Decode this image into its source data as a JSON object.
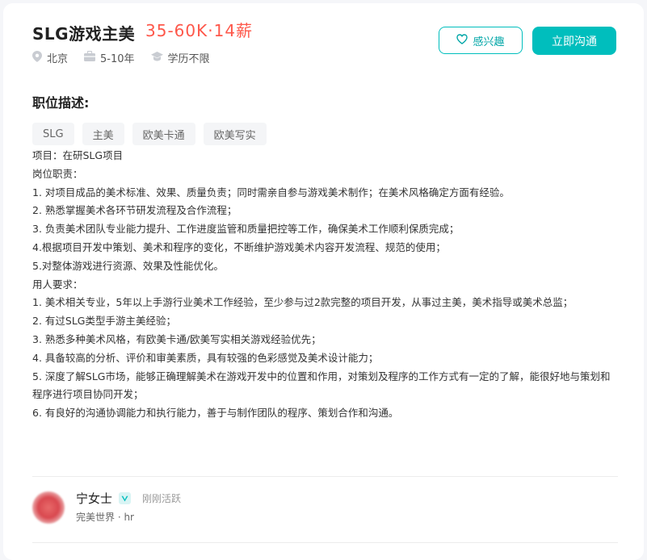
{
  "job": {
    "title": "SLG游戏主美",
    "salary": "35-60K·14薪",
    "location": "北京",
    "experience": "5-10年",
    "education": "学历不限"
  },
  "actions": {
    "interest_label": "感兴趣",
    "contact_label": "立即沟通"
  },
  "description": {
    "section_title": "职位描述:",
    "tags": [
      "SLG",
      "主美",
      "欧美卡通",
      "欧美写实"
    ],
    "lines": [
      "项目：在研SLG项目",
      "岗位职责：",
      "1. 对项目成品的美术标准、效果、质量负责；同时需亲自参与游戏美术制作；在美术风格确定方面有经验。",
      "2. 熟悉掌握美术各环节研发流程及合作流程；",
      "3. 负责美术团队专业能力提升、工作进度监管和质量把控等工作，确保美术工作顺利保质完成；",
      "4.根据项目开发中策划、美术和程序的变化，不断维护游戏美术内容开发流程、规范的使用；",
      "5.对整体游戏进行资源、效果及性能优化。",
      "用人要求：",
      "1. 美术相关专业，5年以上手游行业美术工作经验，至少参与过2款完整的项目开发，从事过主美，美术指导或美术总监；",
      "2. 有过SLG类型手游主美经验；",
      "3. 熟悉多种美术风格，有欧美卡通/欧美写实相关游戏经验优先；",
      "4. 具备较高的分析、评价和审美素质，具有较强的色彩感觉及美术设计能力；",
      "5. 深度了解SLG市场，能够正确理解美术在游戏开发中的位置和作用，对策划及程序的工作方式有一定的了解，能很好地与策划和程序进行项目协同开发；",
      "6. 有良好的沟通协调能力和执行能力，善于与制作团队的程序、策划合作和沟通。"
    ]
  },
  "recruiter": {
    "name": "宁女士",
    "status": "刚刚活跃",
    "company": "完美世界 · hr"
  },
  "colors": {
    "accent": "#00bebd",
    "salary": "#fe574a"
  },
  "icons": [
    "location-icon",
    "briefcase-icon",
    "graduation-cap-icon",
    "heart-icon",
    "verified-icon"
  ]
}
